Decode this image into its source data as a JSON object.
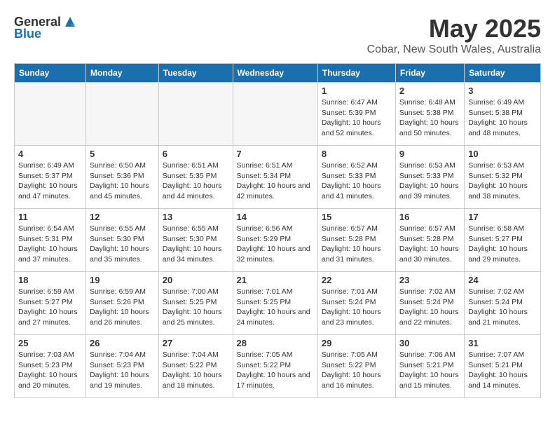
{
  "logo": {
    "general": "General",
    "blue": "Blue"
  },
  "title": "May 2025",
  "subtitle": "Cobar, New South Wales, Australia",
  "days": [
    "Sunday",
    "Monday",
    "Tuesday",
    "Wednesday",
    "Thursday",
    "Friday",
    "Saturday"
  ],
  "weeks": [
    [
      {
        "day": "",
        "info": ""
      },
      {
        "day": "",
        "info": ""
      },
      {
        "day": "",
        "info": ""
      },
      {
        "day": "",
        "info": ""
      },
      {
        "day": "1",
        "info": "Sunrise: 6:47 AM\nSunset: 5:39 PM\nDaylight: 10 hours\nand 52 minutes."
      },
      {
        "day": "2",
        "info": "Sunrise: 6:48 AM\nSunset: 5:38 PM\nDaylight: 10 hours\nand 50 minutes."
      },
      {
        "day": "3",
        "info": "Sunrise: 6:49 AM\nSunset: 5:38 PM\nDaylight: 10 hours\nand 48 minutes."
      }
    ],
    [
      {
        "day": "4",
        "info": "Sunrise: 6:49 AM\nSunset: 5:37 PM\nDaylight: 10 hours\nand 47 minutes."
      },
      {
        "day": "5",
        "info": "Sunrise: 6:50 AM\nSunset: 5:36 PM\nDaylight: 10 hours\nand 45 minutes."
      },
      {
        "day": "6",
        "info": "Sunrise: 6:51 AM\nSunset: 5:35 PM\nDaylight: 10 hours\nand 44 minutes."
      },
      {
        "day": "7",
        "info": "Sunrise: 6:51 AM\nSunset: 5:34 PM\nDaylight: 10 hours\nand 42 minutes."
      },
      {
        "day": "8",
        "info": "Sunrise: 6:52 AM\nSunset: 5:33 PM\nDaylight: 10 hours\nand 41 minutes."
      },
      {
        "day": "9",
        "info": "Sunrise: 6:53 AM\nSunset: 5:33 PM\nDaylight: 10 hours\nand 39 minutes."
      },
      {
        "day": "10",
        "info": "Sunrise: 6:53 AM\nSunset: 5:32 PM\nDaylight: 10 hours\nand 38 minutes."
      }
    ],
    [
      {
        "day": "11",
        "info": "Sunrise: 6:54 AM\nSunset: 5:31 PM\nDaylight: 10 hours\nand 37 minutes."
      },
      {
        "day": "12",
        "info": "Sunrise: 6:55 AM\nSunset: 5:30 PM\nDaylight: 10 hours\nand 35 minutes."
      },
      {
        "day": "13",
        "info": "Sunrise: 6:55 AM\nSunset: 5:30 PM\nDaylight: 10 hours\nand 34 minutes."
      },
      {
        "day": "14",
        "info": "Sunrise: 6:56 AM\nSunset: 5:29 PM\nDaylight: 10 hours\nand 32 minutes."
      },
      {
        "day": "15",
        "info": "Sunrise: 6:57 AM\nSunset: 5:28 PM\nDaylight: 10 hours\nand 31 minutes."
      },
      {
        "day": "16",
        "info": "Sunrise: 6:57 AM\nSunset: 5:28 PM\nDaylight: 10 hours\nand 30 minutes."
      },
      {
        "day": "17",
        "info": "Sunrise: 6:58 AM\nSunset: 5:27 PM\nDaylight: 10 hours\nand 29 minutes."
      }
    ],
    [
      {
        "day": "18",
        "info": "Sunrise: 6:59 AM\nSunset: 5:27 PM\nDaylight: 10 hours\nand 27 minutes."
      },
      {
        "day": "19",
        "info": "Sunrise: 6:59 AM\nSunset: 5:26 PM\nDaylight: 10 hours\nand 26 minutes."
      },
      {
        "day": "20",
        "info": "Sunrise: 7:00 AM\nSunset: 5:25 PM\nDaylight: 10 hours\nand 25 minutes."
      },
      {
        "day": "21",
        "info": "Sunrise: 7:01 AM\nSunset: 5:25 PM\nDaylight: 10 hours\nand 24 minutes."
      },
      {
        "day": "22",
        "info": "Sunrise: 7:01 AM\nSunset: 5:24 PM\nDaylight: 10 hours\nand 23 minutes."
      },
      {
        "day": "23",
        "info": "Sunrise: 7:02 AM\nSunset: 5:24 PM\nDaylight: 10 hours\nand 22 minutes."
      },
      {
        "day": "24",
        "info": "Sunrise: 7:02 AM\nSunset: 5:24 PM\nDaylight: 10 hours\nand 21 minutes."
      }
    ],
    [
      {
        "day": "25",
        "info": "Sunrise: 7:03 AM\nSunset: 5:23 PM\nDaylight: 10 hours\nand 20 minutes."
      },
      {
        "day": "26",
        "info": "Sunrise: 7:04 AM\nSunset: 5:23 PM\nDaylight: 10 hours\nand 19 minutes."
      },
      {
        "day": "27",
        "info": "Sunrise: 7:04 AM\nSunset: 5:22 PM\nDaylight: 10 hours\nand 18 minutes."
      },
      {
        "day": "28",
        "info": "Sunrise: 7:05 AM\nSunset: 5:22 PM\nDaylight: 10 hours\nand 17 minutes."
      },
      {
        "day": "29",
        "info": "Sunrise: 7:05 AM\nSunset: 5:22 PM\nDaylight: 10 hours\nand 16 minutes."
      },
      {
        "day": "30",
        "info": "Sunrise: 7:06 AM\nSunset: 5:21 PM\nDaylight: 10 hours\nand 15 minutes."
      },
      {
        "day": "31",
        "info": "Sunrise: 7:07 AM\nSunset: 5:21 PM\nDaylight: 10 hours\nand 14 minutes."
      }
    ]
  ]
}
